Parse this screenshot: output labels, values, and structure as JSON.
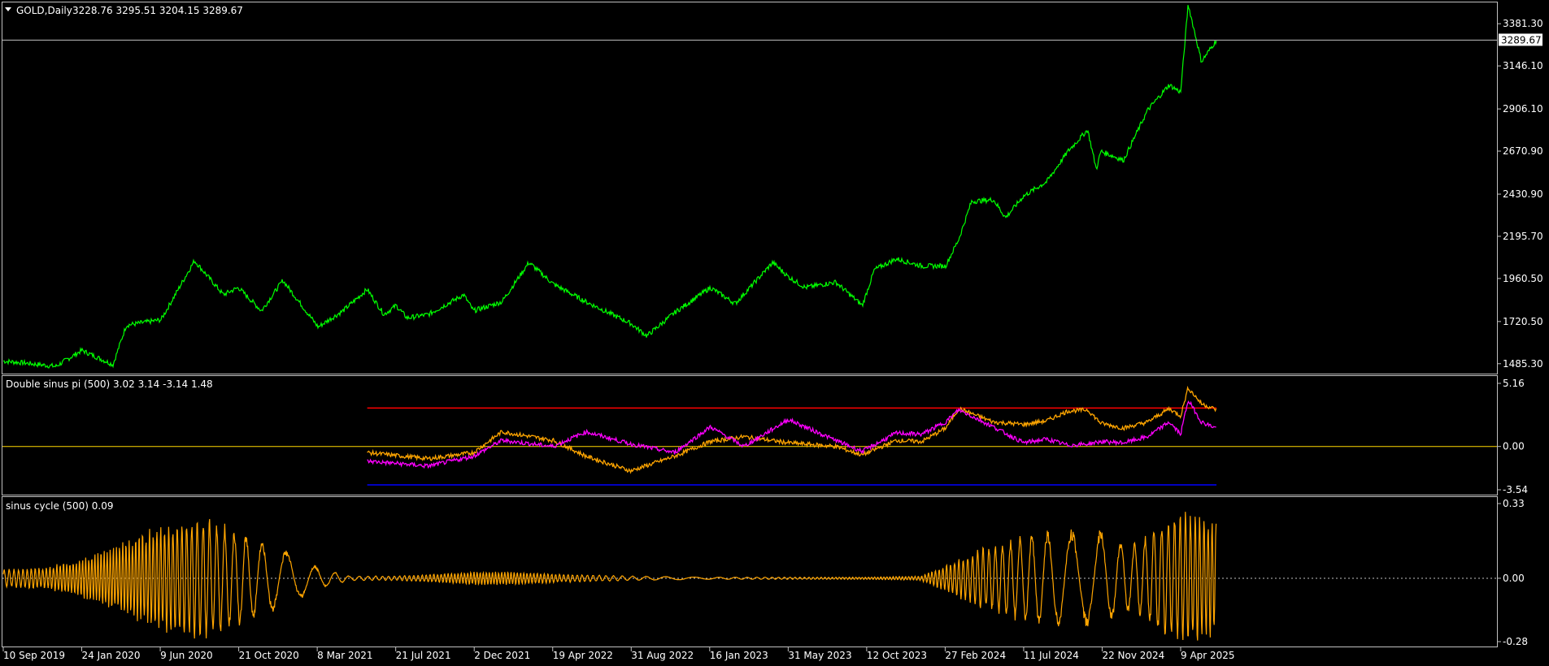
{
  "chart_data": [
    {
      "type": "line",
      "title": "GOLD,Daily",
      "ohlc": "3228.76 3295.51 3204.15 3289.67",
      "color": "#00ff00",
      "ylim": [
        1430,
        3500
      ],
      "y_ticks": [
        "3381.30",
        "3146.10",
        "2906.10",
        "2670.90",
        "2430.90",
        "2195.70",
        "1960.50",
        "1720.50",
        "1485.30"
      ],
      "current_price": "3289.67",
      "x_ticks": [
        "10 Sep 2019",
        "24 Jan 2020",
        "9 Jun 2020",
        "21 Oct 2020",
        "8 Mar 2021",
        "21 Jul 2021",
        "2 Dec 2021",
        "19 Apr 2022",
        "31 Aug 2022",
        "16 Jan 2023",
        "31 May 2023",
        "12 Oct 2023",
        "27 Feb 2024",
        "11 Jul 2024",
        "22 Nov 2024",
        "9 Apr 2025"
      ],
      "series": [
        {
          "x": [
            "2019-09-10",
            "2019-10-15",
            "2019-12-10",
            "2020-01-24",
            "2020-03-18",
            "2020-04-10",
            "2020-06-09",
            "2020-08-06",
            "2020-09-25",
            "2020-10-21",
            "2020-11-30",
            "2021-01-06",
            "2021-03-08",
            "2021-04-20",
            "2021-06-01",
            "2021-06-30",
            "2021-07-21",
            "2021-08-09",
            "2021-09-15",
            "2021-11-15",
            "2021-12-02",
            "2022-01-20",
            "2022-03-08",
            "2022-04-19",
            "2022-06-15",
            "2022-08-31",
            "2022-09-28",
            "2022-11-15",
            "2023-01-16",
            "2023-02-28",
            "2023-05-04",
            "2023-05-31",
            "2023-06-29",
            "2023-08-21",
            "2023-10-06",
            "2023-10-27",
            "2023-12-04",
            "2024-01-17",
            "2024-02-27",
            "2024-03-21",
            "2024-04-12",
            "2024-05-20",
            "2024-06-10",
            "2024-07-11",
            "2024-08-20",
            "2024-09-26",
            "2024-10-30",
            "2024-11-14",
            "2024-11-22",
            "2024-12-31",
            "2025-02-11",
            "2025-03-20",
            "2025-04-09",
            "2025-04-22",
            "2025-05-15",
            "2025-06-10"
          ],
          "y": [
            1500,
            1490,
            1470,
            1560,
            1480,
            1700,
            1730,
            2060,
            1870,
            1910,
            1780,
            1950,
            1690,
            1780,
            1900,
            1760,
            1810,
            1740,
            1760,
            1870,
            1780,
            1830,
            2050,
            1930,
            1830,
            1710,
            1640,
            1770,
            1910,
            1820,
            2050,
            1970,
            1910,
            1940,
            1810,
            2010,
            2070,
            2030,
            2030,
            2180,
            2390,
            2400,
            2300,
            2420,
            2500,
            2670,
            2790,
            2570,
            2670,
            2620,
            2900,
            3040,
            3000,
            3490,
            3170,
            3290
          ]
        }
      ]
    },
    {
      "type": "line",
      "title": "Double sinus pi (500) 3.02 3.14 -3.14 1.48",
      "ylim": [
        -3.54,
        5.16
      ],
      "y_ticks": [
        "5.16",
        "0.00",
        "-3.54"
      ],
      "levels": [
        {
          "value": 3.14,
          "color": "#ff0000"
        },
        {
          "value": 0,
          "color": "#ffd700"
        },
        {
          "value": -3.14,
          "color": "#0000ff"
        }
      ],
      "series": [
        {
          "color": "#ffa500",
          "x": [
            "2021-06-01",
            "2021-09-15",
            "2021-12-02",
            "2022-01-20",
            "2022-04-19",
            "2022-06-15",
            "2022-08-31",
            "2022-11-15",
            "2023-01-16",
            "2023-03-15",
            "2023-05-31",
            "2023-08-21",
            "2023-10-06",
            "2023-12-04",
            "2024-01-17",
            "2024-02-27",
            "2024-03-21",
            "2024-05-20",
            "2024-07-11",
            "2024-08-20",
            "2024-09-26",
            "2024-10-30",
            "2024-11-22",
            "2024-12-31",
            "2025-02-11",
            "2025-03-20",
            "2025-04-09",
            "2025-04-22",
            "2025-05-15",
            "2025-06-10"
          ],
          "y": [
            -0.5,
            -1.0,
            -0.5,
            1.2,
            0.5,
            -0.8,
            -2.0,
            -0.8,
            0.4,
            0.8,
            0.3,
            0.0,
            -0.7,
            0.5,
            0.4,
            1.5,
            3.1,
            2.0,
            1.8,
            2.1,
            2.9,
            3.0,
            1.9,
            1.5,
            2.0,
            3.1,
            2.5,
            4.8,
            3.5,
            3.0
          ]
        },
        {
          "color": "#ff00ff",
          "x": [
            "2021-06-01",
            "2021-09-15",
            "2021-12-02",
            "2022-01-20",
            "2022-04-19",
            "2022-06-15",
            "2022-08-31",
            "2022-11-15",
            "2023-01-16",
            "2023-03-15",
            "2023-05-31",
            "2023-08-21",
            "2023-10-06",
            "2023-12-04",
            "2024-01-17",
            "2024-02-27",
            "2024-03-21",
            "2024-05-20",
            "2024-07-11",
            "2024-08-20",
            "2024-09-26",
            "2024-10-30",
            "2024-11-22",
            "2024-12-31",
            "2025-02-11",
            "2025-03-20",
            "2025-04-09",
            "2025-04-22",
            "2025-05-15",
            "2025-06-10"
          ],
          "y": [
            -1.2,
            -1.6,
            -0.8,
            0.5,
            0.0,
            1.2,
            0.2,
            -0.5,
            1.6,
            0.0,
            2.2,
            0.5,
            -0.4,
            1.1,
            1.0,
            2.0,
            3.0,
            1.6,
            0.3,
            0.6,
            0.1,
            0.2,
            0.4,
            0.3,
            0.8,
            2.0,
            1.0,
            3.8,
            2.0,
            1.5
          ]
        }
      ]
    },
    {
      "type": "line",
      "title": "sinus cycle (500) 0.09",
      "color": "#ffa500",
      "ylim": [
        -0.28,
        0.33
      ],
      "y_ticks": [
        "0.33",
        "0.00",
        "-0.28"
      ],
      "envelope": {
        "x": [
          "2019-09-10",
          "2019-11-20",
          "2020-01-24",
          "2020-04-01",
          "2020-06-09",
          "2020-08-15",
          "2020-10-21",
          "2021-01-10",
          "2021-03-08",
          "2021-05-01",
          "2021-07-21",
          "2021-10-01",
          "2021-12-02",
          "2022-02-15",
          "2022-04-19",
          "2022-08-31",
          "2023-01-16",
          "2023-05-31",
          "2023-10-12",
          "2024-01-15",
          "2024-02-27",
          "2024-05-01",
          "2024-07-11",
          "2024-09-15",
          "2024-11-22",
          "2025-01-15",
          "2025-03-01",
          "2025-04-09",
          "2025-05-15",
          "2025-06-10"
        ],
        "amplitude": [
          0.04,
          0.05,
          0.09,
          0.16,
          0.25,
          0.28,
          0.22,
          0.13,
          0.05,
          0.01,
          0.01,
          0.02,
          0.03,
          0.03,
          0.02,
          0.01,
          0.005,
          0.005,
          0.005,
          0.01,
          0.06,
          0.14,
          0.2,
          0.22,
          0.22,
          0.15,
          0.25,
          0.3,
          0.3,
          0.25
        ]
      }
    }
  ]
}
